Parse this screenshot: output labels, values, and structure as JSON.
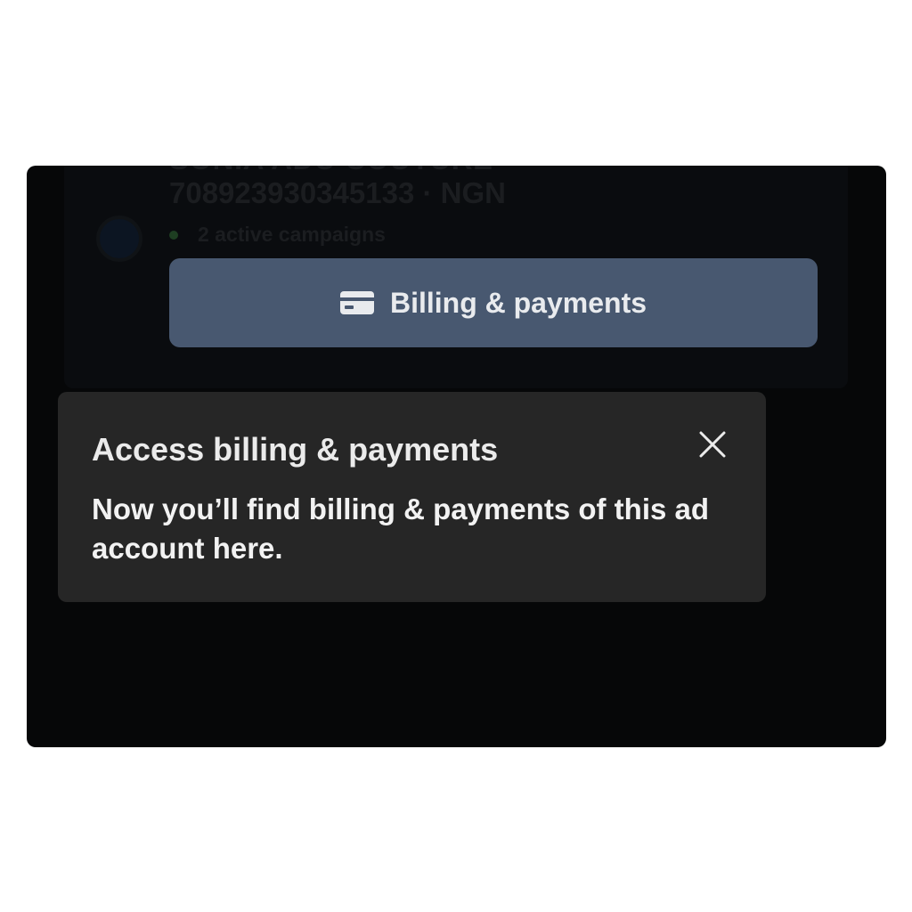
{
  "account": {
    "name": "SONIA ADU COUTURE",
    "id_currency": "708923930345133 · NGN",
    "campaigns": "2 active campaigns"
  },
  "billing_button": {
    "label": "Billing & payments",
    "icon": "credit-card-icon"
  },
  "tooltip": {
    "title": "Access billing & payments",
    "body": "Now you’ll find billing & payments of this ad account here.",
    "close_icon": "close-icon"
  },
  "colors": {
    "overlay": "#060708",
    "button": "#485870",
    "tooltip": "#262626",
    "text": "#f2f2f2"
  }
}
